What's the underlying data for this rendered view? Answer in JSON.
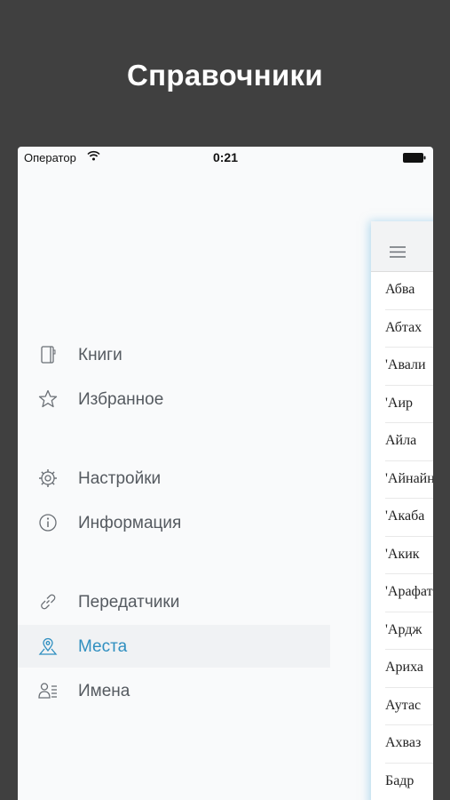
{
  "promo": {
    "title": "Справочники"
  },
  "statusbar": {
    "carrier": "Оператор",
    "time": "0:21"
  },
  "menu": {
    "items": [
      {
        "label": "Книги",
        "icon": "book-icon"
      },
      {
        "label": "Избранное",
        "icon": "star-icon"
      },
      {
        "label": "Настройки",
        "icon": "gear-icon"
      },
      {
        "label": "Информация",
        "icon": "info-icon"
      },
      {
        "label": "Передатчики",
        "icon": "link-icon"
      },
      {
        "label": "Места",
        "icon": "location-pin-icon",
        "active": true
      },
      {
        "label": "Имена",
        "icon": "person-list-icon"
      }
    ]
  },
  "places_list": {
    "items": [
      "Абва",
      "Абтах",
      "'Авали",
      "'Аир",
      "Айла",
      "'Айнайн",
      "'Акаба",
      "'Акик",
      "'Арафат",
      "'Ардж",
      "Ариха",
      "Аутас",
      "Ахваз",
      "Бадр"
    ]
  },
  "colors": {
    "accent": "#2f8fc0",
    "background": "#404040",
    "menu_text": "#555a60"
  }
}
